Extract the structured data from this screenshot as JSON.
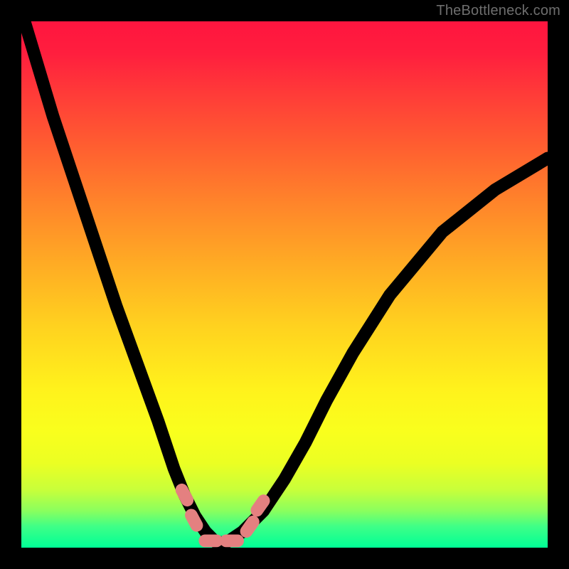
{
  "watermark": "TheBottleneck.com",
  "colors": {
    "frame_background": "#000000",
    "curve_stroke": "#000000",
    "marker_fill": "#e48080",
    "gradient_top": "#ff153f",
    "gradient_bottom": "#00ff96"
  },
  "chart_data": {
    "type": "line",
    "title": "",
    "xlabel": "",
    "ylabel": "",
    "xlim": [
      0,
      100
    ],
    "ylim": [
      0,
      100
    ],
    "grid": false,
    "legend": false,
    "note": "x and y are percentages of the plot area; y=0 is the bottom (green) edge, y=100 is the top (red) edge.",
    "series": [
      {
        "name": "bottleneck-curve",
        "x": [
          0,
          3,
          6,
          10,
          14,
          18,
          22,
          26,
          29,
          31,
          33,
          35,
          37,
          39,
          42,
          46,
          50,
          54,
          58,
          63,
          70,
          80,
          90,
          100
        ],
        "y": [
          102,
          92,
          82,
          70,
          58,
          46,
          35,
          24,
          15,
          10,
          6,
          3,
          1,
          1,
          3,
          7,
          13,
          20,
          28,
          37,
          48,
          60,
          68,
          74
        ]
      }
    ],
    "markers": [
      {
        "x": 31.0,
        "y": 10.0,
        "rot": 62
      },
      {
        "x": 32.8,
        "y": 5.2,
        "rot": 62
      },
      {
        "x": 36.0,
        "y": 1.3,
        "rot": 0
      },
      {
        "x": 40.0,
        "y": 1.3,
        "rot": 0
      },
      {
        "x": 43.4,
        "y": 4.0,
        "rot": -55
      },
      {
        "x": 45.4,
        "y": 8.0,
        "rot": -55
      }
    ],
    "marker_size": {
      "w": 4.6,
      "h": 2.4,
      "rx": 1.2
    }
  }
}
